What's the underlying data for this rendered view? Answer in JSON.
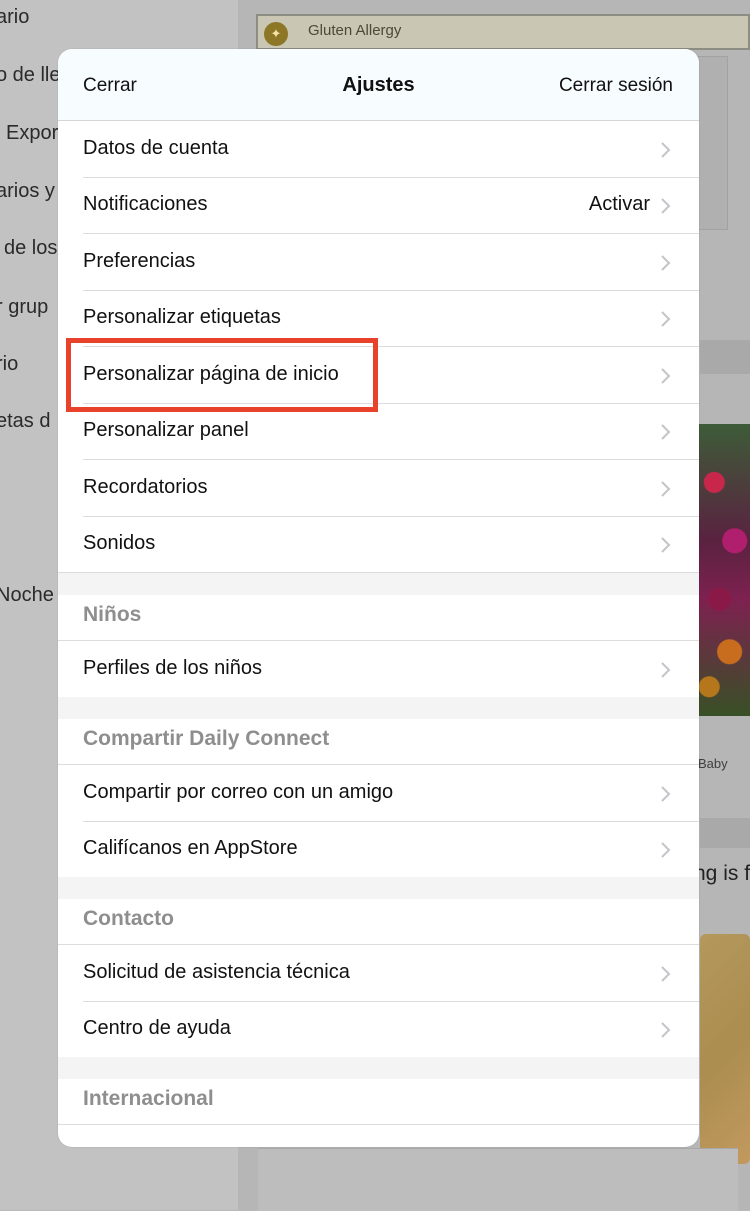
{
  "background": {
    "left_items": [
      "ario",
      "o de lle",
      "Expor",
      "arios y",
      "de los",
      "r grup",
      "rio",
      "etas d",
      "Noche"
    ],
    "gluten_label": "Gluten Allergy",
    "baby_label": "Baby",
    "fragment": "ng is f"
  },
  "modal": {
    "close_label": "Cerrar",
    "title": "Ajustes",
    "logout_label": "Cerrar sesión"
  },
  "general_items": [
    {
      "label": "Datos de cuenta",
      "value": ""
    },
    {
      "label": "Notificaciones",
      "value": "Activar"
    },
    {
      "label": "Preferencias",
      "value": ""
    },
    {
      "label": "Personalizar etiquetas",
      "value": ""
    },
    {
      "label": "Personalizar página de inicio",
      "value": ""
    },
    {
      "label": "Personalizar panel",
      "value": ""
    },
    {
      "label": "Recordatorios",
      "value": ""
    },
    {
      "label": "Sonidos",
      "value": ""
    }
  ],
  "sections": {
    "kids": {
      "title": "Niños",
      "items": [
        "Perfiles de los niños"
      ]
    },
    "share": {
      "title": "Compartir Daily Connect",
      "items": [
        "Compartir por correo con un amigo",
        "Califícanos en AppStore"
      ]
    },
    "contact": {
      "title": "Contacto",
      "items": [
        "Solicitud de asistencia técnica",
        "Centro de ayuda"
      ]
    },
    "international": {
      "title": "Internacional"
    }
  },
  "colors": {
    "highlight": "#e8412c",
    "section_header_text": "#8e8e8e",
    "chevron": "#c4c4c9"
  }
}
